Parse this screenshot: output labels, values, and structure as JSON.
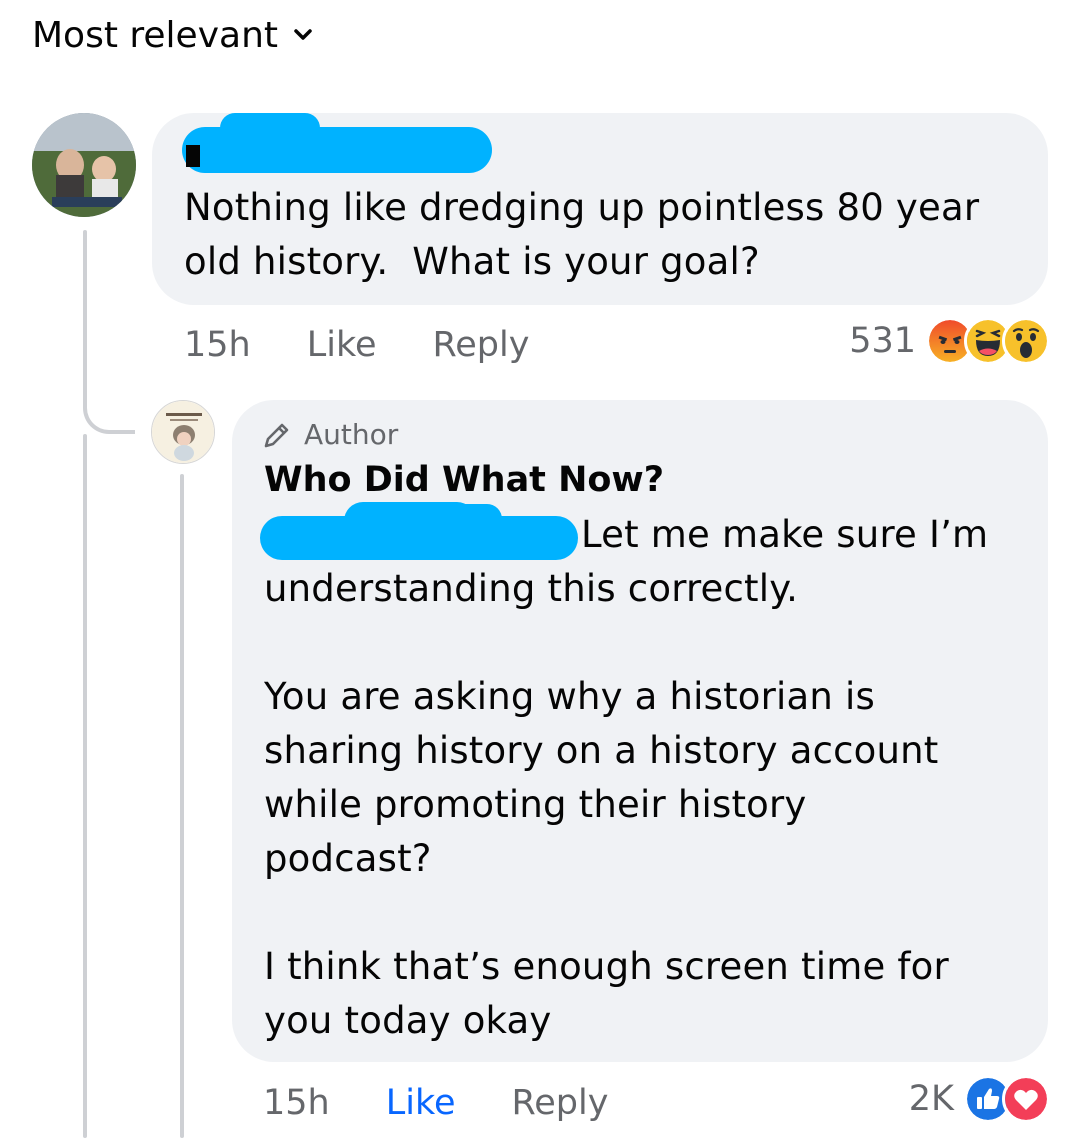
{
  "sort": {
    "label": "Most relevant"
  },
  "comment": {
    "text": "Nothing like dredging up pointless 80 year\nold history.  What is your goal?",
    "time": "15h",
    "like_label": "Like",
    "reply_label": "Reply",
    "reaction_count": "531",
    "reactions": [
      "angry-reaction",
      "haha-reaction",
      "wow-reaction"
    ]
  },
  "reply": {
    "badge_label": "Author",
    "author_name": "Who Did What Now?",
    "first_line": "Let me make sure I’m",
    "rest_text": "understanding this correctly.\n\nYou are asking why a historian is\nsharing history on a history account\nwhile promoting their history\npodcast?\n\nI think that’s enough screen time for\nyou today okay",
    "time": "15h",
    "like_label": "Like",
    "reply_label": "Reply",
    "reaction_count": "2K",
    "reactions": [
      "like-reaction",
      "love-reaction"
    ]
  },
  "colors": {
    "bubble": "#f0f2f5",
    "meta": "#65676b",
    "like_active": "#0866ff",
    "redaction": "#00b2ff"
  }
}
